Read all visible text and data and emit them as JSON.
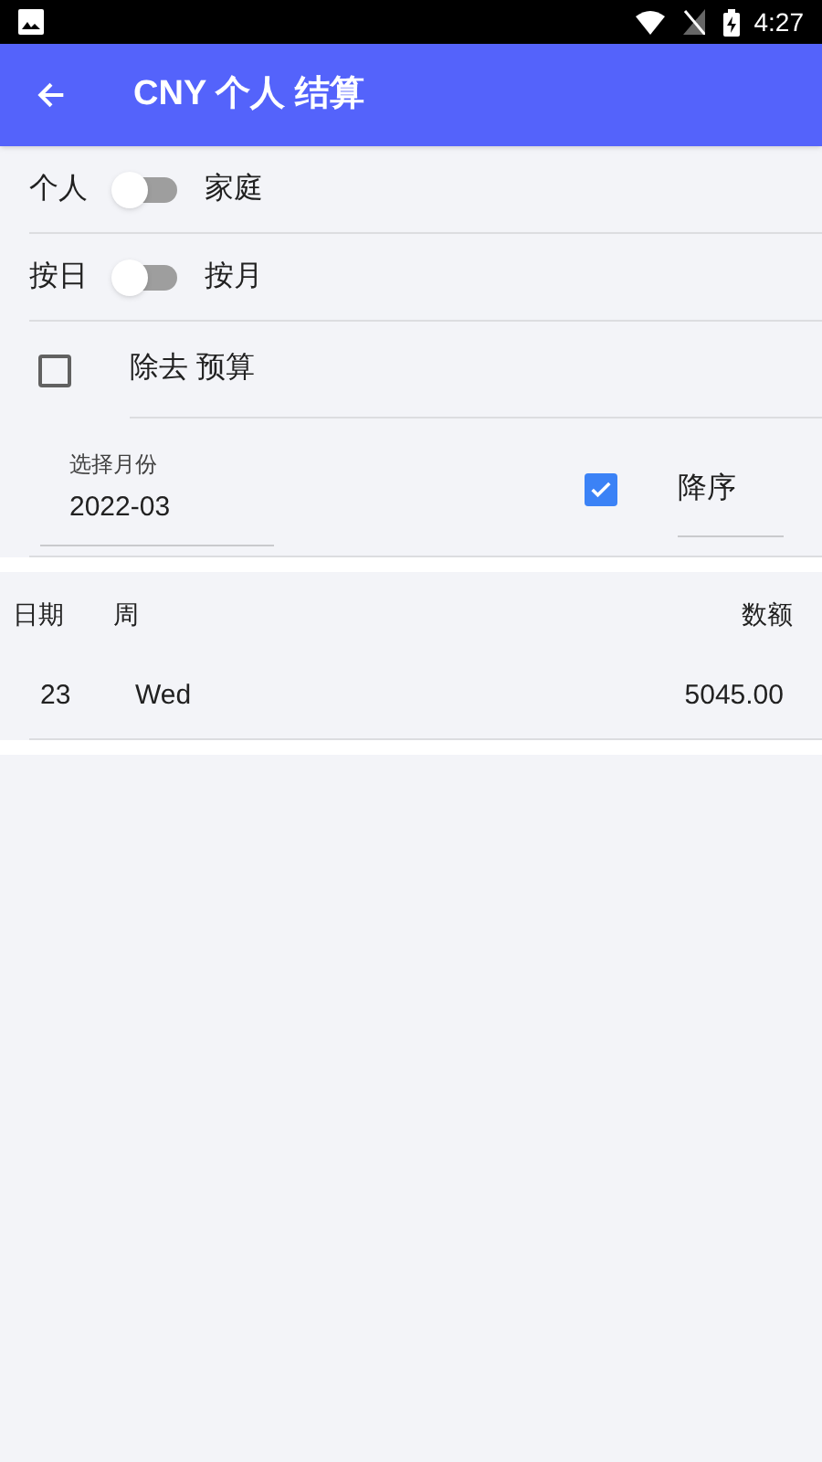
{
  "status_bar": {
    "time": "4:27"
  },
  "app_bar": {
    "title": "CNY 个人 结算"
  },
  "toggles": [
    {
      "left_label": "个人",
      "right_label": "家庭",
      "on": false
    },
    {
      "left_label": "按日",
      "right_label": "按月",
      "on": false
    }
  ],
  "exclude_budget": {
    "label": "除去 预算",
    "checked": false
  },
  "month_field": {
    "label": "选择月份",
    "value": "2022-03"
  },
  "descending": {
    "label": "降序",
    "checked": true
  },
  "table": {
    "columns": [
      "日期",
      "周",
      "数额"
    ],
    "rows": [
      {
        "date": "23",
        "weekday": "Wed",
        "amount": "5045.00"
      }
    ]
  }
}
